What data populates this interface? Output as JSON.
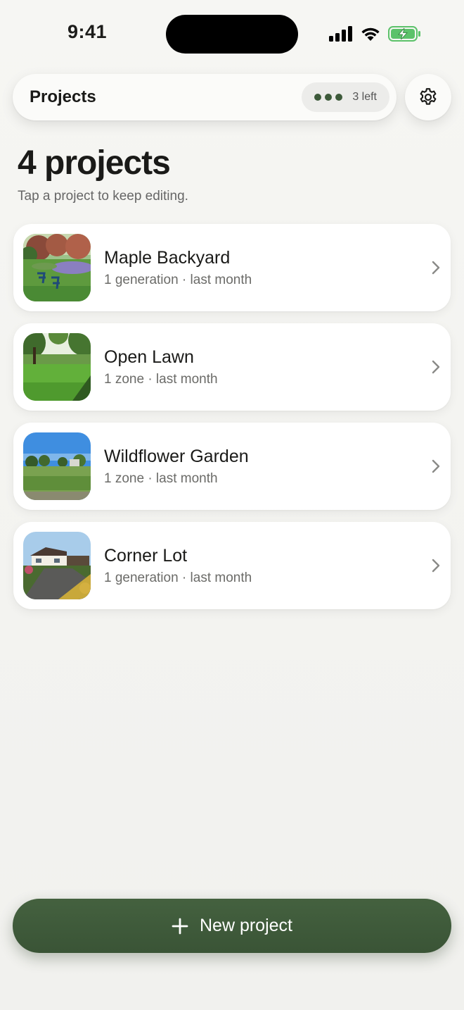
{
  "status_bar": {
    "time": "9:41"
  },
  "header": {
    "title": "Projects",
    "credits_label": "3 left",
    "settings_icon": "gear-icon"
  },
  "page": {
    "title": "4 projects",
    "subtitle": "Tap a project to keep editing."
  },
  "projects": [
    {
      "name": "Maple Backyard",
      "meta": "1 generation · last month",
      "thumbnail": "backyard-photo"
    },
    {
      "name": "Open Lawn",
      "meta": "1 zone · last month",
      "thumbnail": "lawn-photo"
    },
    {
      "name": "Wildflower Garden",
      "meta": "1 zone · last month",
      "thumbnail": "garden-photo"
    },
    {
      "name": "Corner Lot",
      "meta": "1 generation · last month",
      "thumbnail": "house-photo"
    }
  ],
  "new_project": {
    "label": "New project",
    "icon": "plus-icon"
  },
  "colors": {
    "accent": "#3d5a3a",
    "background": "#f4f4f1"
  }
}
